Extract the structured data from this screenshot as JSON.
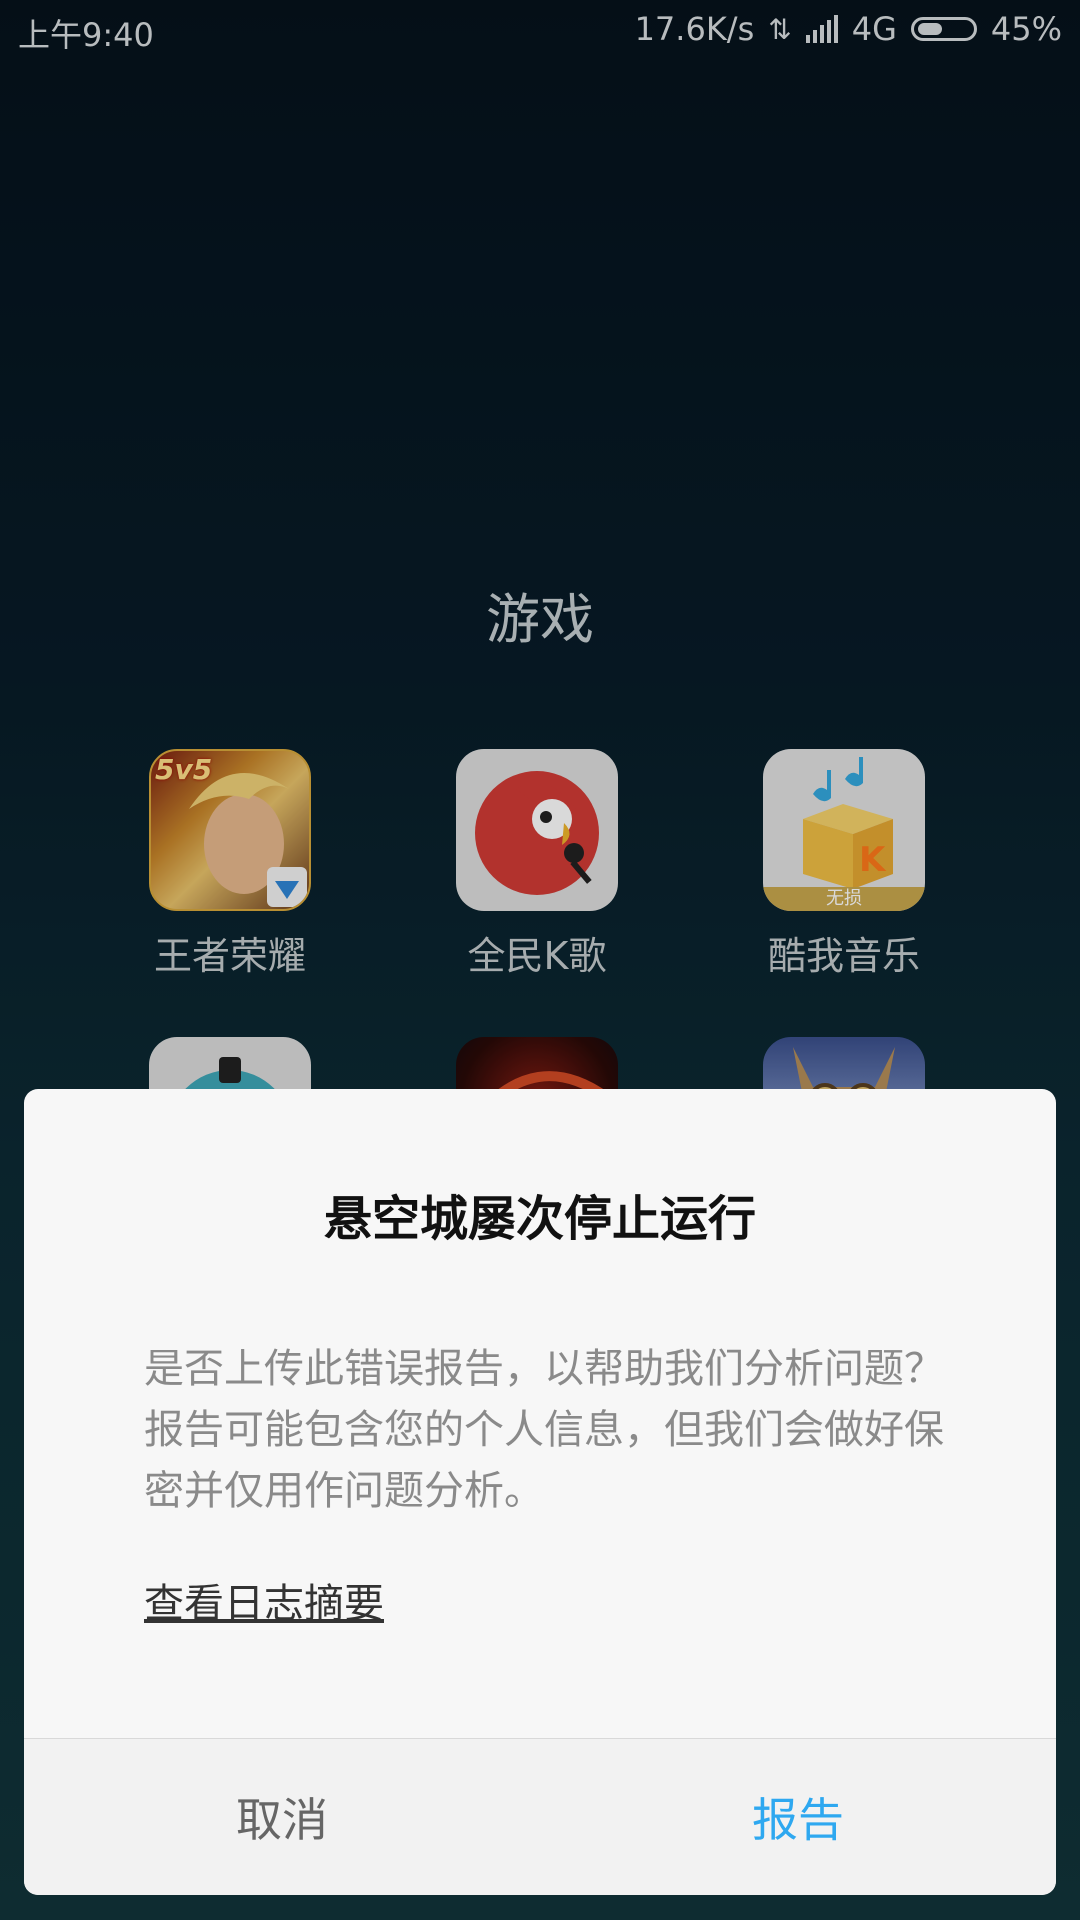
{
  "status_bar": {
    "time": "上午9:40",
    "speed": "17.6K/s",
    "network": "4G",
    "battery": "45%",
    "battery_level": 0.45
  },
  "folder": {
    "title": "游戏",
    "apps": [
      {
        "label": "王者荣耀",
        "icon": "honor-of-kings-icon",
        "badge": "5v5"
      },
      {
        "label": "全民K歌",
        "icon": "karaoke-parrot-icon"
      },
      {
        "label": "酷我音乐",
        "icon": "kuwo-music-box-icon",
        "badge": "无损"
      },
      {
        "label": "",
        "icon": "teal-game-icon"
      },
      {
        "label": "",
        "icon": "dark-red-game-icon"
      },
      {
        "label": "",
        "icon": "cat-aviator-game-icon"
      }
    ]
  },
  "dialog": {
    "title": "悬空城屡次停止运行",
    "message": "是否上传此错误报告，以帮助我们分析问题？报告可能包含您的个人信息，但我们会做好保密并仅用作问题分析。",
    "link": "查看日志摘要",
    "cancel_label": "取消",
    "report_label": "报告",
    "accent_color": "#2ea8f0"
  }
}
